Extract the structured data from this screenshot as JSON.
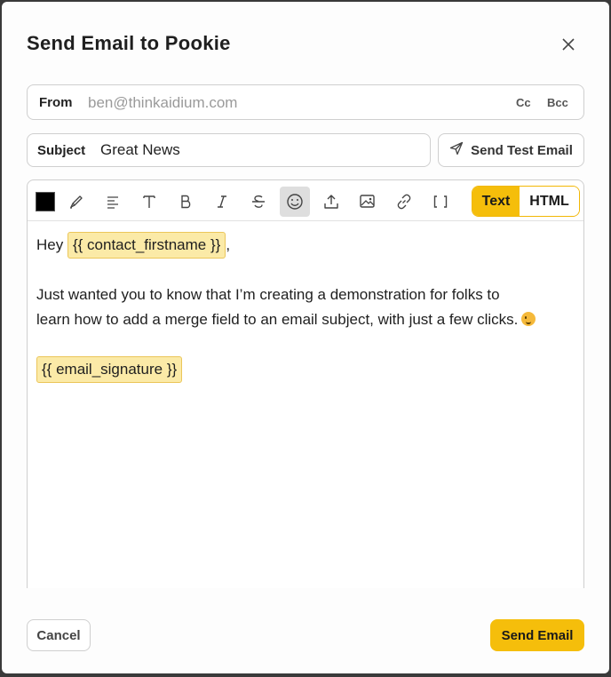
{
  "dialog": {
    "title": "Send Email to Pookie"
  },
  "from": {
    "label": "From",
    "value": "ben@thinkaidium.com",
    "cc_label": "Cc",
    "bcc_label": "Bcc"
  },
  "subject": {
    "label": "Subject",
    "value": "Great News"
  },
  "test_email": {
    "label": "Send Test Email"
  },
  "toolbar": {
    "text_color": "#000000",
    "items": [
      "color-swatch",
      "highlighter-icon",
      "align-left-icon",
      "text-size-icon",
      "bold-icon",
      "italic-icon",
      "strikethrough-icon",
      "emoji-icon",
      "upload-icon",
      "image-icon",
      "link-icon",
      "merge-field-icon"
    ],
    "mode_text": "Text",
    "mode_html": "HTML",
    "active_mode": "Text"
  },
  "body": {
    "greeting": "Hey",
    "firstname_tag": "{{ contact_firstname }}",
    "comma": ",",
    "line1": "Just wanted you to know that I’m creating a demonstration for folks to",
    "line2": "learn how to add a merge field to an email subject, with just a few clicks.",
    "emoji": "winking-face",
    "signature_tag": "{{ email_signature }}"
  },
  "footer": {
    "cancel_label": "Cancel",
    "send_label": "Send Email"
  },
  "colors": {
    "accent": "#f5be0b",
    "merge_bg": "#fbeaa7"
  }
}
